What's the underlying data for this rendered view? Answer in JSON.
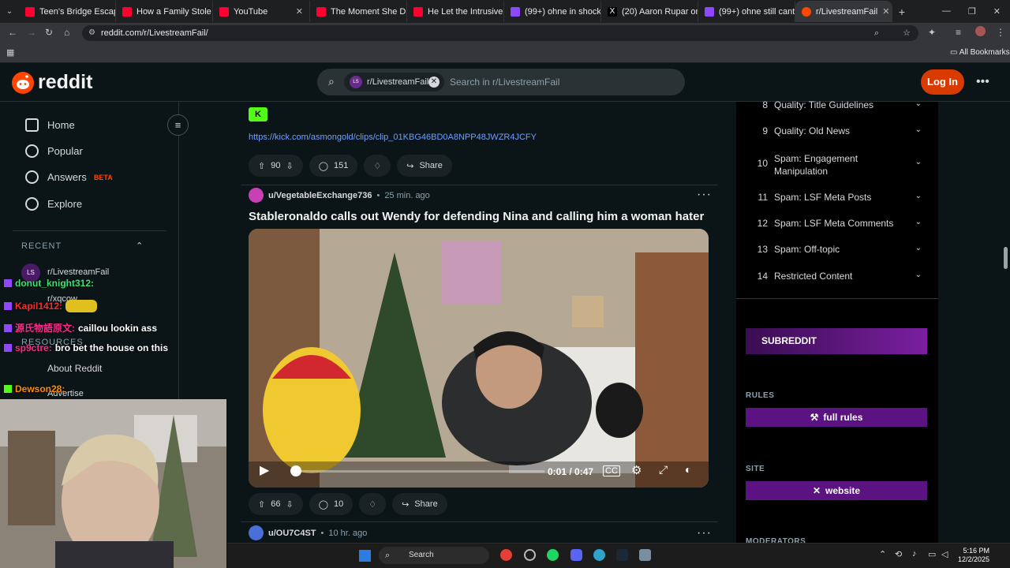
{
  "browser": {
    "tabs": [
      {
        "title": "Teen's Bridge Escape",
        "color": "#ff0033"
      },
      {
        "title": "How a Family Stole $",
        "color": "#ff0033"
      },
      {
        "title": "YouTube",
        "color": "#ff0033"
      },
      {
        "title": "The Moment She Dis",
        "color": "#ff0033"
      },
      {
        "title": "He Let the Intrusive T",
        "color": "#ff0033"
      },
      {
        "title": "(99+) ohne in shock :",
        "color": "#9146ff"
      },
      {
        "title": "(20) Aaron Rupar on",
        "color": "#ffffff"
      },
      {
        "title": "(99+) ohne still cant :",
        "color": "#9146ff"
      },
      {
        "title": "r/LivestreamFail",
        "color": "#ff4500"
      }
    ],
    "url": "reddit.com/r/LivestreamFail/",
    "all_bookmarks": "All Bookmarks"
  },
  "header": {
    "logo_text": "reddit",
    "search_chip": "r/LivestreamFail",
    "search_chip_avatar": "LS",
    "search_placeholder": "Search in r/LivestreamFail",
    "login": "Log In"
  },
  "sidebar": {
    "nav": [
      {
        "label": "Home",
        "icon": "home-icon"
      },
      {
        "label": "Popular",
        "icon": "popular-icon"
      },
      {
        "label": "Answers",
        "icon": "answers-icon"
      },
      {
        "label": "Explore",
        "icon": "explore-icon"
      }
    ],
    "answers_badge": "BETA",
    "recent_heading": "RECENT",
    "recent_items": [
      "r/LivestreamFail",
      "r/xqcow"
    ],
    "resources_heading": "RESOURCES",
    "resources_items": [
      "About Reddit",
      "Advertise"
    ]
  },
  "chat_overlay": [
    {
      "user": "donut_knight312:",
      "message": "",
      "color": "#3ae374"
    },
    {
      "user": "Kapil1412:",
      "message": "",
      "color": "#ff2a2a"
    },
    {
      "user": "源氏物語原文:",
      "message": "caillou lookin ass",
      "color": "#ff2a8a"
    },
    {
      "user": "sp9ctre:",
      "message": "bro bet the house on this",
      "color": "#ff2a8a"
    },
    {
      "user": "Dewson28:",
      "message": "",
      "color": "#ff8a00"
    }
  ],
  "feed": {
    "prev_post_link": "https://kick.com/asmongold/clips/clip_01KBG46BD0A8NPP48JWZR4JCFY",
    "prev_post_votes": "90",
    "prev_post_comments": "151",
    "share_label": "Share",
    "post": {
      "author": "u/VegetableExchange736",
      "time": "25 min. ago",
      "title": "Stableronaldo calls out Wendy for defending Nina and calling him a woman hater",
      "video_time": "0:01 / 0:47",
      "votes": "66",
      "comments": "10"
    },
    "next_post": {
      "author": "u/OU7C4ST",
      "time": "10 hr. ago"
    }
  },
  "rules": [
    {
      "num": "8",
      "text": "Quality: Title Guidelines"
    },
    {
      "num": "9",
      "text": "Quality: Old News"
    },
    {
      "num": "10",
      "text": "Spam: Engagement Manipulation"
    },
    {
      "num": "11",
      "text": "Spam: LSF Meta Posts"
    },
    {
      "num": "12",
      "text": "Spam: LSF Meta Comments"
    },
    {
      "num": "13",
      "text": "Spam: Off-topic"
    },
    {
      "num": "14",
      "text": "Restricted Content"
    }
  ],
  "right_widgets": {
    "banner_text": "SUBREDDIT",
    "rules_heading": "RULES",
    "rules_button": "full rules",
    "site_heading": "SITE",
    "site_button": "website",
    "moderators_heading": "MODERATORS"
  },
  "taskbar": {
    "search": "Search",
    "time": "5:16 PM",
    "date": "12/2/2025"
  }
}
